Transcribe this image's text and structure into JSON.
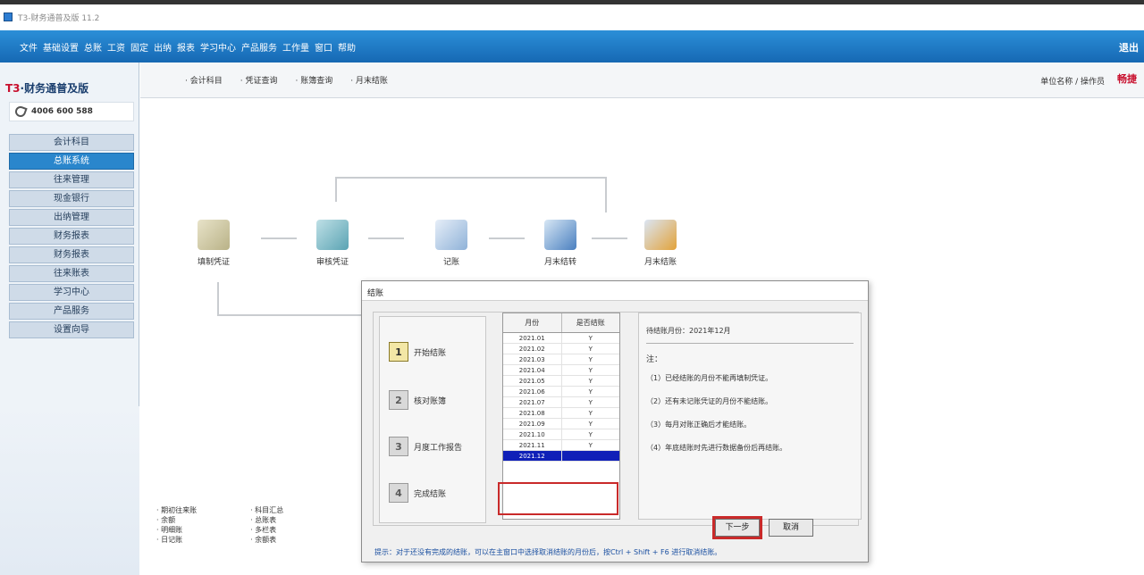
{
  "window": {
    "title": "T3-财务通普及版 11.2"
  },
  "menubar": {
    "items": [
      "文件",
      "基础设置",
      "总账",
      "工资",
      "固定",
      "出纳",
      "报表",
      "学习中心",
      "产品服务",
      "工作量",
      "窗口",
      "帮助"
    ],
    "right_label": "退出"
  },
  "sidebar": {
    "logo_prefix": "T3",
    "logo_text": "·财务通普及版",
    "phone": "4006 600 588",
    "items": [
      {
        "label": "会计科目",
        "active": false
      },
      {
        "label": "总账系统",
        "active": true
      },
      {
        "label": "往来管理",
        "active": false
      },
      {
        "label": "现金银行",
        "active": false
      },
      {
        "label": "出纳管理",
        "active": false
      },
      {
        "label": "财务报表",
        "active": false
      },
      {
        "label": "财务报表",
        "active": false
      },
      {
        "label": "往来账表",
        "active": false
      },
      {
        "label": "学习中心",
        "active": false
      },
      {
        "label": "产品服务",
        "active": false
      },
      {
        "label": "设置向导",
        "active": false
      }
    ]
  },
  "toolbar": {
    "tabs": [
      "· 会计科目",
      "· 凭证查询",
      "· 账簿查询",
      "· 月末结账"
    ],
    "user": "单位名称 / 操作员",
    "brand": "畅捷"
  },
  "workflow": {
    "nodes": [
      {
        "label": "填制凭证",
        "icon": "edit-voucher-icon"
      },
      {
        "label": "审核凭证",
        "icon": "review-voucher-icon"
      },
      {
        "label": "记账",
        "icon": "posting-icon"
      },
      {
        "label": "月末结转",
        "icon": "month-end-transfer-icon"
      },
      {
        "label": "月末结账",
        "icon": "month-end-close-icon"
      }
    ]
  },
  "bottom_links": {
    "col1": [
      "· 期初往来账",
      "· 余额",
      "· 明细账",
      "· 日记账"
    ],
    "col2": [
      "· 科目汇总",
      "· 总账表",
      "· 多栏表",
      "· 余额表"
    ]
  },
  "dialog": {
    "title": "结账",
    "steps": [
      {
        "label": "开始结账",
        "icon": "1",
        "active": true
      },
      {
        "label": "核对账簿",
        "icon": "2",
        "active": false
      },
      {
        "label": "月度工作报告",
        "icon": "3",
        "active": false
      },
      {
        "label": "完成结账",
        "icon": "4",
        "active": false
      }
    ],
    "table": {
      "headers": [
        "月份",
        "是否结账"
      ],
      "rows": [
        [
          "2021.01",
          "Y"
        ],
        [
          "2021.02",
          "Y"
        ],
        [
          "2021.03",
          "Y"
        ],
        [
          "2021.04",
          "Y"
        ],
        [
          "2021.05",
          "Y"
        ],
        [
          "2021.06",
          "Y"
        ],
        [
          "2021.07",
          "Y"
        ],
        [
          "2021.08",
          "Y"
        ],
        [
          "2021.09",
          "Y"
        ],
        [
          "2021.10",
          "Y"
        ],
        [
          "2021.11",
          "Y"
        ],
        [
          "2021.12",
          ""
        ]
      ],
      "selected_index": 11
    },
    "info": {
      "header": "待结账月份：2021年12月",
      "subtitle": "注：",
      "lines": [
        "（1）已经结账的月份不能再填制凭证。",
        "（2）还有未记账凭证的月份不能结账。",
        "（3）每月对账正确后才能结账。",
        "（4）年底结账时先进行数据备份后再结账。"
      ]
    },
    "buttons": {
      "next": "下一步",
      "cancel": "取消"
    },
    "hint": "提示：对于还没有完成的结账，可以在主窗口中选择取消结账的月份后，按Ctrl + Shift + F6 进行取消结账。"
  }
}
